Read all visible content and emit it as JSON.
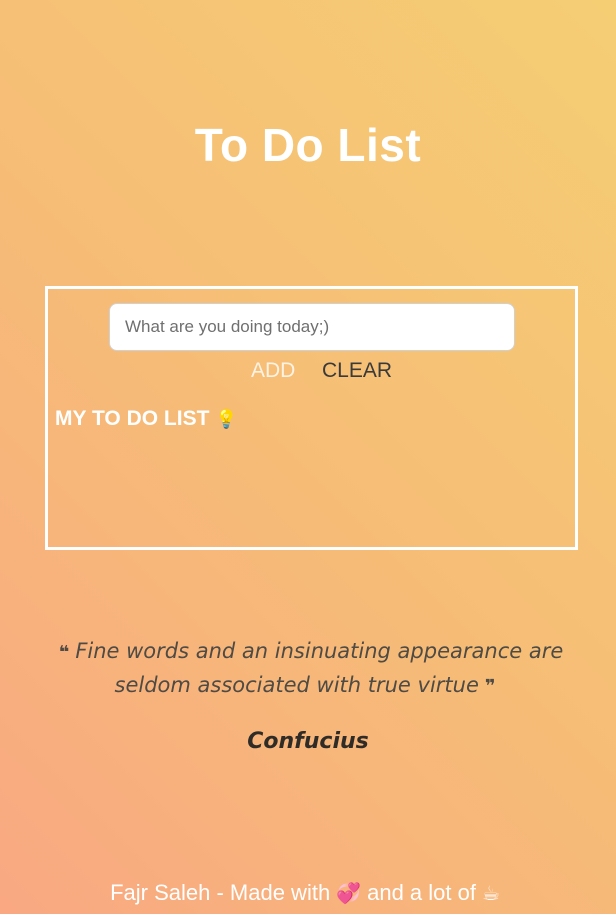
{
  "header": {
    "title": "To Do List"
  },
  "todo": {
    "input_placeholder": "What are you doing today;)",
    "input_value": "",
    "add_label": "ADD",
    "clear_label": "CLEAR",
    "list_heading": "MY TO DO LIST",
    "list_icon": "lightbulb-icon",
    "items": []
  },
  "quote": {
    "open_mark": "❝",
    "text": "Fine words and an insinuating appearance are seldom associated with true virtue",
    "close_mark": "❞",
    "author": "Confucius"
  },
  "footer": {
    "text_before": "Fajr Saleh - Made with",
    "heart_icon": "💞",
    "text_middle": "and a lot of",
    "coffee_icon": "☕"
  },
  "colors": {
    "gradient_start": "#f9a882",
    "gradient_end": "#f5ce74",
    "add_button": "#fdf3e4",
    "clear_button": "#3a3a3a"
  }
}
